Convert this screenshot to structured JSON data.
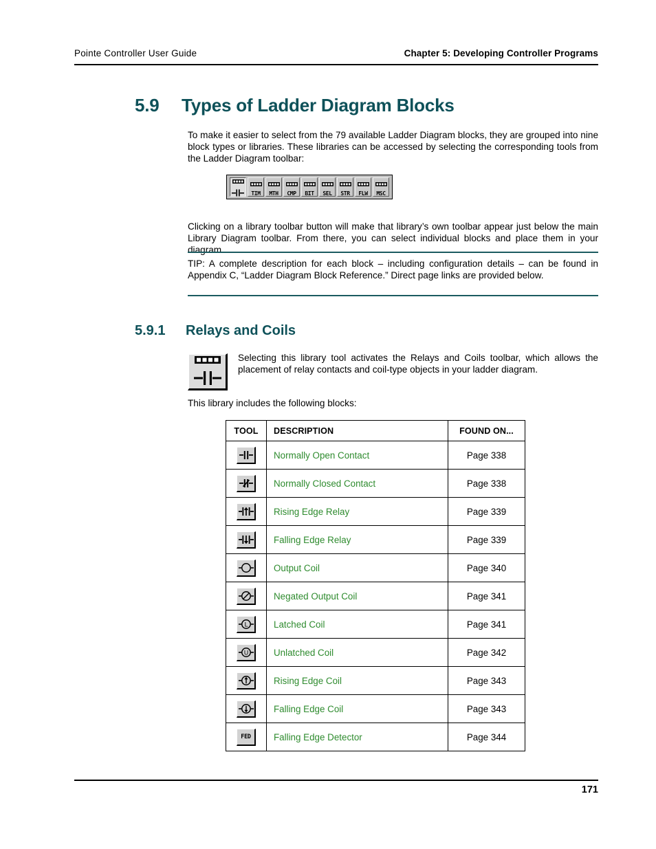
{
  "header": {
    "left": "Pointe Controller User Guide",
    "right": "Chapter 5: Developing Controller Programs"
  },
  "section": {
    "number": "5.9",
    "title": "Types of Ladder Diagram Blocks"
  },
  "paragraphs": {
    "intro": "To make it easier to select from the 79 available Ladder Diagram blocks, they are grouped into nine block types or libraries. These libraries can be accessed by selecting the corresponding tools from the Ladder Diagram toolbar:",
    "clicking": "Clicking on a library toolbar button will make that library’s own toolbar appear just below the main Library Diagram toolbar. From there, you can select individual blocks and place them in your diagram.",
    "tip": "TIP: A complete description for each block – including configuration details – can be found in Appendix C, “Ladder Diagram Block Reference.” Direct page links are provided below.",
    "selecting": "Selecting this library tool activates the Relays and Coils toolbar, which allows  the placement of relay contacts and coil-type objects in your ladder diagram.",
    "this_library": "This library includes the following blocks:"
  },
  "toolbar": {
    "buttons": [
      {
        "label": "",
        "icon": "contact-icon",
        "pressed": true
      },
      {
        "label": "TIM",
        "icon": "dots-icon",
        "pressed": false
      },
      {
        "label": "MTH",
        "icon": "dots-icon",
        "pressed": false
      },
      {
        "label": "CMP",
        "icon": "dots-icon",
        "pressed": false
      },
      {
        "label": "BIT",
        "icon": "dots-icon",
        "pressed": false
      },
      {
        "label": "SEL",
        "icon": "dots-icon",
        "pressed": false
      },
      {
        "label": "STR",
        "icon": "dots-icon",
        "pressed": false
      },
      {
        "label": "FLW",
        "icon": "dots-icon",
        "pressed": false
      },
      {
        "label": "MSC",
        "icon": "dots-icon",
        "pressed": false
      }
    ]
  },
  "subsection": {
    "number": "5.9.1",
    "title": "Relays and Coils",
    "library_icon": "relays-and-coils-library-icon"
  },
  "table": {
    "columns": [
      "TOOL",
      "DESCRIPTION",
      "FOUND ON..."
    ],
    "rows": [
      {
        "icon": "normally-open-contact-icon",
        "description": "Normally Open Contact",
        "found_on": "Page 338"
      },
      {
        "icon": "normally-closed-contact-icon",
        "description": "Normally Closed Contact",
        "found_on": "Page 338"
      },
      {
        "icon": "rising-edge-relay-icon",
        "description": "Rising Edge Relay",
        "found_on": "Page 339"
      },
      {
        "icon": "falling-edge-relay-icon",
        "description": "Falling Edge Relay",
        "found_on": "Page 339"
      },
      {
        "icon": "output-coil-icon",
        "description": "Output Coil",
        "found_on": "Page 340"
      },
      {
        "icon": "negated-output-coil-icon",
        "description": "Negated Output Coil",
        "found_on": "Page 341"
      },
      {
        "icon": "latched-coil-icon",
        "description": "Latched Coil",
        "found_on": "Page 341"
      },
      {
        "icon": "unlatched-coil-icon",
        "description": "Unlatched Coil",
        "found_on": "Page 342"
      },
      {
        "icon": "rising-edge-coil-icon",
        "description": "Rising Edge Coil",
        "found_on": "Page 343"
      },
      {
        "icon": "falling-edge-coil-icon",
        "description": "Falling Edge Coil",
        "found_on": "Page 343"
      },
      {
        "icon": "falling-edge-detector-icon",
        "description": "Falling Edge Detector",
        "found_on": "Page 344",
        "label": "FED"
      }
    ]
  },
  "footer": {
    "page_number": "171"
  },
  "colors": {
    "heading": "#0e5159",
    "link": "#2e8b2e",
    "rule": "#1b5b60"
  }
}
